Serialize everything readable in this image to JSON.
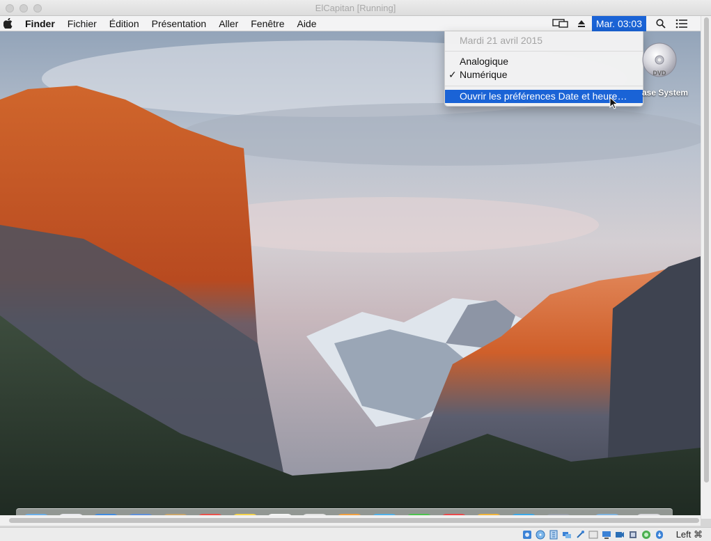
{
  "window": {
    "title": "ElCapitan [Running]"
  },
  "menubar": {
    "app_name": "Finder",
    "items": [
      "Fichier",
      "Édition",
      "Présentation",
      "Aller",
      "Fenêtre",
      "Aide"
    ],
    "clock": "Mar. 03:03"
  },
  "clock_menu": {
    "date": "Mardi 21 avril 2015",
    "options": [
      {
        "label": "Analogique",
        "checked": false
      },
      {
        "label": "Numérique",
        "checked": true
      }
    ],
    "check_mark": "✓",
    "open_prefs": "Ouvrir les préférences Date et heure…"
  },
  "desktop": {
    "icon_label": "ase System",
    "icon_badge": "DVD"
  },
  "statusbar": {
    "host_key": "Left ⌘"
  },
  "colors": {
    "accent": "#1a63d6"
  }
}
